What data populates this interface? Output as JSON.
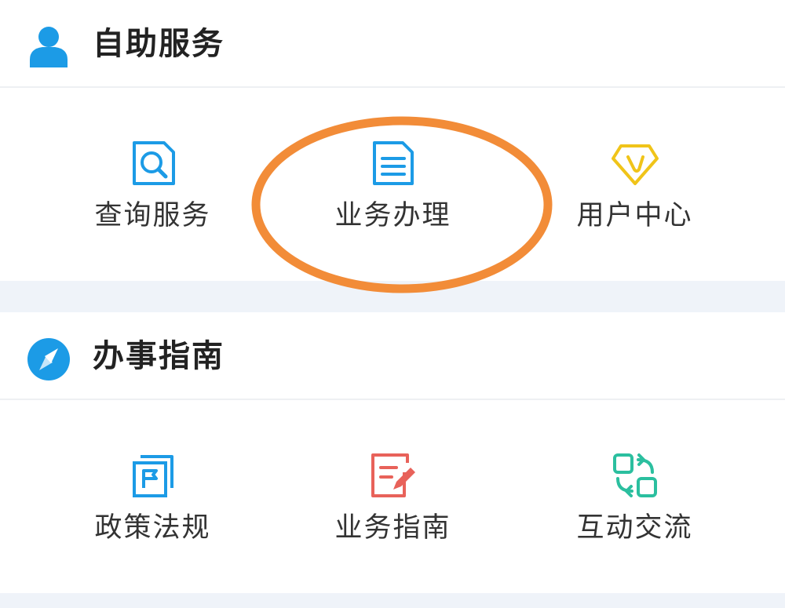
{
  "self_service": {
    "title": "自助服务",
    "icon": "user-icon",
    "items": [
      {
        "label": "查询服务",
        "icon": "search-document-icon",
        "color": "#1c9be6"
      },
      {
        "label": "业务办理",
        "icon": "document-icon",
        "color": "#1c9be6",
        "highlighted": true
      },
      {
        "label": "用户中心",
        "icon": "diamond-vip-icon",
        "color": "#f0c419"
      }
    ]
  },
  "guide": {
    "title": "办事指南",
    "icon": "compass-icon",
    "items": [
      {
        "label": "政策法规",
        "icon": "flag-document-icon",
        "color": "#1c9be6"
      },
      {
        "label": "业务指南",
        "icon": "edit-document-icon",
        "color": "#e8625a"
      },
      {
        "label": "互动交流",
        "icon": "swap-interaction-icon",
        "color": "#2bbf9f"
      }
    ]
  },
  "colors": {
    "accent_blue": "#1c9be6",
    "highlight_orange": "#f28c38",
    "separator_bg": "#eff3f9"
  }
}
